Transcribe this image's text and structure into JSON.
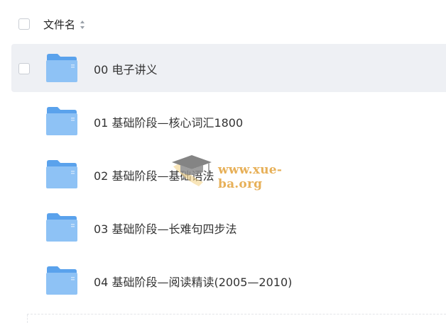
{
  "header": {
    "column_title": "文件名"
  },
  "rows": [
    {
      "name": "00 电子讲义",
      "selected": true
    },
    {
      "name": "01 基础阶段—核心词汇1800",
      "selected": false
    },
    {
      "name": "02 基础阶段—基础语法",
      "selected": false
    },
    {
      "name": "03 基础阶段—长难句四步法",
      "selected": false
    },
    {
      "name": "04 基础阶段—阅读精读(2005—2010)",
      "selected": false
    }
  ],
  "watermark": {
    "text": "www.xue-ba.org"
  },
  "colors": {
    "folder_front": "#8ec2f5",
    "folder_back": "#5aa2ec",
    "selected_row": "#eef0f4",
    "watermark": "#e3a33c"
  },
  "icons": [
    "checkbox-icon",
    "sort-icon",
    "folder-icon",
    "graduation-cap-icon"
  ]
}
